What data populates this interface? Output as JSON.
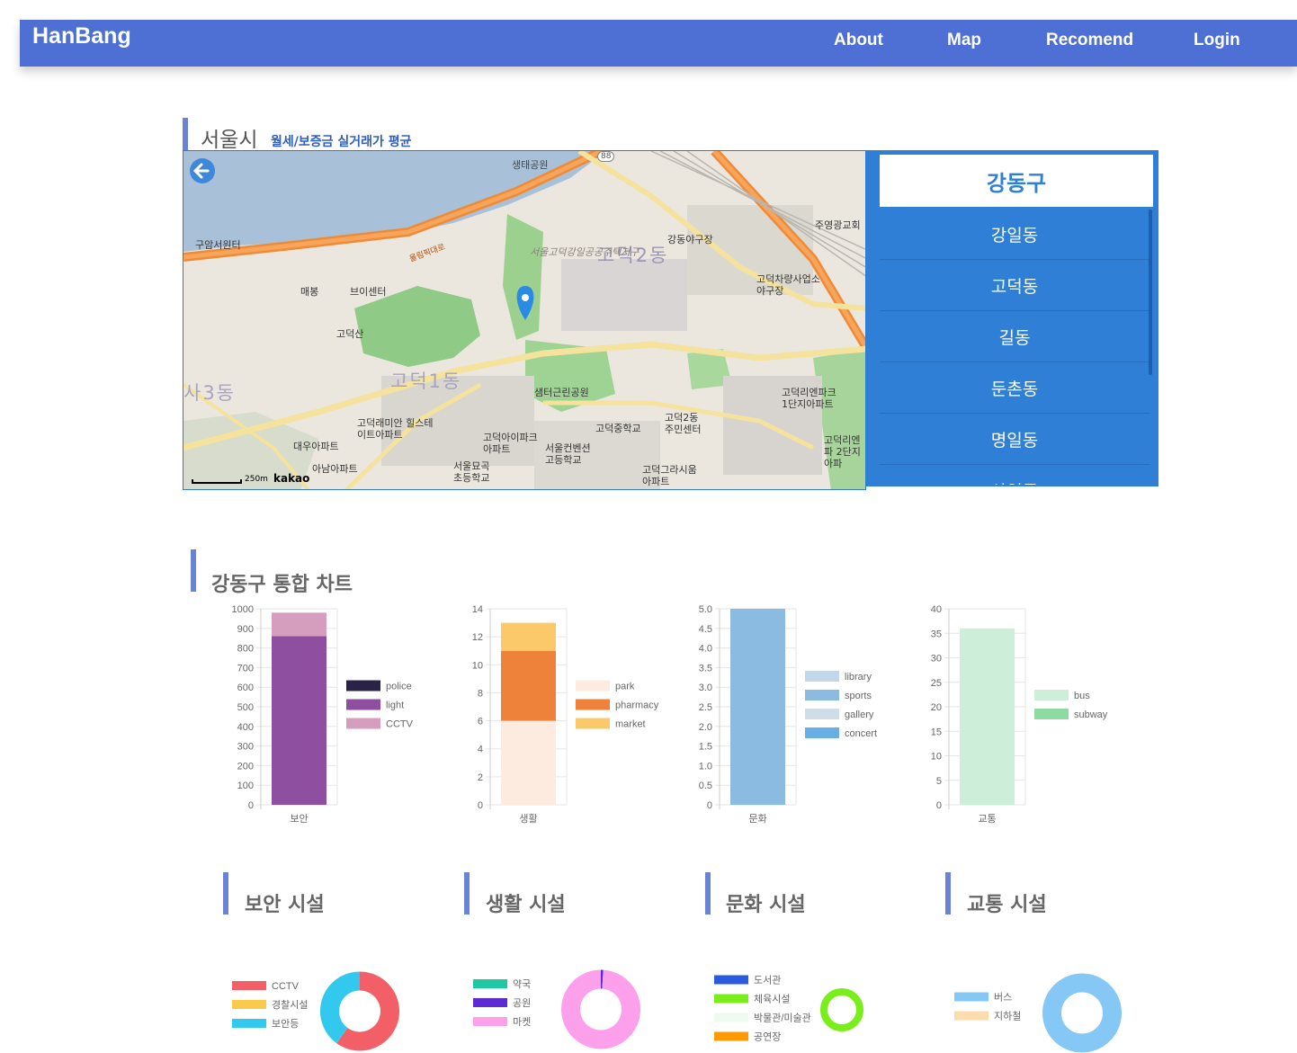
{
  "navbar": {
    "brand": "HanBang",
    "links": [
      "About",
      "Map",
      "Recomend",
      "Login"
    ]
  },
  "map_section": {
    "city": "서울시",
    "subtitle": "월세/보증금 실거래가 평균",
    "selected_gu": "강동구",
    "dongs": [
      "강일동",
      "고덕동",
      "길동",
      "둔촌동",
      "명일동",
      "상일동"
    ],
    "map_labels": {
      "district_1": "고덕2동",
      "district_2": "고덕1동",
      "district_3": "사3동",
      "place_1": "생태공원",
      "place_2": "강동야구장",
      "place_3": "구암서원터",
      "place_4": "매봉",
      "place_5": "브이센터",
      "place_6": "고덕산",
      "place_7": "샘터근린공원",
      "place_8": "고덕중학교",
      "place_9": "고덕2동 주민센터",
      "place_10": "고덕래미안 힐스테이트아파트",
      "place_11": "고덕아이파크 아파트",
      "place_12": "서울컨벤션 고등학교",
      "place_13": "서울묘곡 초등학교",
      "place_14": "대우아파트",
      "place_15": "아남아파트",
      "place_16": "고덕그라시움 아파트",
      "place_17": "고덕리엔파크 1단지아파트",
      "place_18": "고덕리엔파 2단지아파",
      "place_19": "고덕차량사업소 야구장",
      "place_20": "주영광교회",
      "place_21": "서울고덕강일공공주택지구",
      "road_1": "올림픽대로",
      "road_2": "88",
      "scale": "250m",
      "kakao": "kakao"
    }
  },
  "integrated_chart": {
    "title": "강동구 통합 차트"
  },
  "chart_data": [
    {
      "type": "bar",
      "stacked": true,
      "categories": [
        "보안"
      ],
      "series": [
        {
          "name": "police",
          "values": [
            0
          ],
          "color": "#2a2347"
        },
        {
          "name": "light",
          "values": [
            860
          ],
          "color": "#8e4fa0"
        },
        {
          "name": "CCTV",
          "values": [
            120
          ],
          "color": "#d59ebf"
        }
      ],
      "ylim": [
        0,
        1000
      ],
      "yticks": [
        "0",
        "100",
        "200",
        "300",
        "400",
        "500",
        "600",
        "700",
        "800",
        "900",
        "1000"
      ]
    },
    {
      "type": "bar",
      "stacked": true,
      "categories": [
        "생활"
      ],
      "series": [
        {
          "name": "park",
          "values": [
            6
          ],
          "color": "#fdebdf"
        },
        {
          "name": "pharmacy",
          "values": [
            5
          ],
          "color": "#ef823b"
        },
        {
          "name": "market",
          "values": [
            2
          ],
          "color": "#fbc96a"
        }
      ],
      "ylim": [
        0,
        14
      ],
      "yticks": [
        "0",
        "2",
        "4",
        "6",
        "8",
        "10",
        "12",
        "14"
      ]
    },
    {
      "type": "bar",
      "stacked": true,
      "categories": [
        "문화"
      ],
      "series": [
        {
          "name": "library",
          "values": [
            0
          ],
          "color": "#c3d6ea"
        },
        {
          "name": "sports",
          "values": [
            5
          ],
          "color": "#8bbbe0"
        },
        {
          "name": "gallery",
          "values": [
            0
          ],
          "color": "#d0dde9"
        },
        {
          "name": "concert",
          "values": [
            0
          ],
          "color": "#6aaee6"
        }
      ],
      "ylim": [
        0,
        5
      ],
      "yticks": [
        "0",
        "0.5",
        "1.0",
        "1.5",
        "2.0",
        "2.5",
        "3.0",
        "3.5",
        "4.0",
        "4.5",
        "5.0"
      ]
    },
    {
      "type": "bar",
      "stacked": true,
      "categories": [
        "교통"
      ],
      "series": [
        {
          "name": "bus",
          "values": [
            36
          ],
          "color": "#cdeed8"
        },
        {
          "name": "subway",
          "values": [
            0
          ],
          "color": "#8edba2"
        }
      ],
      "ylim": [
        0,
        40
      ],
      "yticks": [
        "0",
        "5",
        "10",
        "15",
        "20",
        "25",
        "30",
        "35",
        "40"
      ]
    },
    {
      "type": "pie",
      "donut": true,
      "title": "보안 시설",
      "labels": [
        "CCTV",
        "경찰시설",
        "보안등"
      ],
      "values": [
        60,
        0,
        40
      ],
      "colors": [
        "#f25f66",
        "#fbc94b",
        "#33c9ee"
      ]
    },
    {
      "type": "pie",
      "donut": true,
      "title": "생활 시설",
      "labels": [
        "약국",
        "공원",
        "마켓"
      ],
      "values": [
        0,
        1,
        99
      ],
      "colors": [
        "#21c7a2",
        "#5d2bd2",
        "#fda0ec"
      ]
    },
    {
      "type": "pie",
      "donut": true,
      "title": "문화 시설",
      "labels": [
        "도서관",
        "체육시설",
        "박물관/미술관",
        "공연장"
      ],
      "values": [
        0,
        100,
        0,
        0
      ],
      "colors": [
        "#2a5bde",
        "#7aee1a",
        "#eefbee",
        "#ff9a07"
      ]
    },
    {
      "type": "pie",
      "donut": true,
      "title": "교통 시설",
      "labels": [
        "버스",
        "지하철"
      ],
      "values": [
        100,
        0
      ],
      "colors": [
        "#85c8f5",
        "#fddcab"
      ]
    }
  ]
}
